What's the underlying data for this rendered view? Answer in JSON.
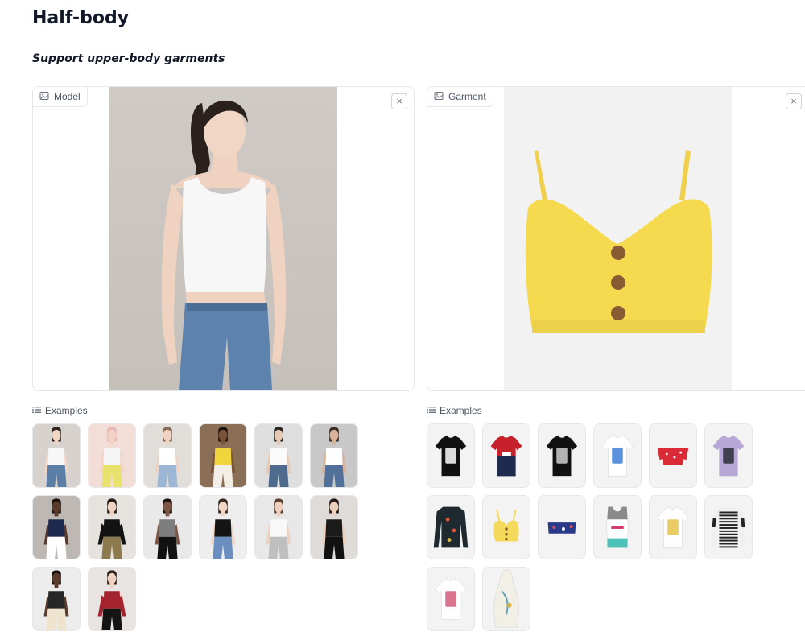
{
  "page": {
    "title": "Half-body",
    "subtitle": "Support upper-body garments"
  },
  "model_input": {
    "label": "Model",
    "label_icon": "image-icon",
    "close_icon": "close-icon",
    "close_symbol": "×"
  },
  "garment_input": {
    "label": "Garment",
    "label_icon": "image-icon",
    "close_icon": "close-icon",
    "close_symbol": "×"
  },
  "model_examples": {
    "label": "Examples",
    "icon": "list-icon",
    "items": [
      {
        "bg": "#d7d2cd",
        "skin": "#f0d5c4",
        "hair": "#2b2421",
        "top": "#f7f7f7",
        "bottom": "#5b7ea6",
        "sleeve": false
      },
      {
        "bg": "#f3ddd7",
        "skin": "#f2d3c5",
        "hair": "#e8b8b5",
        "top": "#f5f5f5",
        "bottom": "#e9e16d",
        "sleeve": false
      },
      {
        "bg": "#e1ddd9",
        "skin": "#f0d3c2",
        "hair": "#8b6e58",
        "top": "#ffffff",
        "bottom": "#9cb7d4",
        "sleeve": false
      },
      {
        "bg": "#8a6e55",
        "skin": "#7a5237",
        "hair": "#1e1510",
        "top": "#f2d53c",
        "bottom": "#f3efe6",
        "sleeve": false
      },
      {
        "bg": "#dedede",
        "skin": "#e6c8b4",
        "hair": "#2a2523",
        "top": "#fbfbfb",
        "bottom": "#4e6b8e",
        "sleeve": false
      },
      {
        "bg": "#c8c8c8",
        "skin": "#d8b39a",
        "hair": "#3a2d25",
        "top": "#ffffff",
        "bottom": "#52719a",
        "sleeve": false
      },
      {
        "bg": "#bdb8b3",
        "skin": "#5a3a2a",
        "hair": "#1c1410",
        "top": "#1f2a4f",
        "bottom": "#ffffff",
        "sleeve": false
      },
      {
        "bg": "#e6e3df",
        "skin": "#efd3c1",
        "hair": "#1f1a18",
        "top": "#121212",
        "bottom": "#8c7a4e",
        "sleeve": true
      },
      {
        "bg": "#e9e9e9",
        "skin": "#7d5441",
        "hair": "#1a1410",
        "top": "#7d7d7d",
        "bottom": "#111111",
        "sleeve": false
      },
      {
        "bg": "#eeeeee",
        "skin": "#f0d6c6",
        "hair": "#3a2a22",
        "top": "#141414",
        "bottom": "#6a8fbf",
        "sleeve": false
      },
      {
        "bg": "#e8e8e8",
        "skin": "#edd0bf",
        "hair": "#5c3f30",
        "top": "#f8f8f8",
        "bottom": "#bfbfbf",
        "sleeve": false
      },
      {
        "bg": "#dedbd8",
        "skin": "#eccfbd",
        "hair": "#231c19",
        "top": "#1a1a1a",
        "bottom": "#111111",
        "sleeve": false
      },
      {
        "bg": "#ececec",
        "skin": "#5b3b2b",
        "hair": "#1a1410",
        "top": "#262626",
        "bottom": "#ede3cf",
        "sleeve": false
      },
      {
        "bg": "#e7e4e1",
        "skin": "#efd2c1",
        "hair": "#2a211d",
        "top": "#a3232f",
        "bottom": "#141414",
        "sleeve": true
      }
    ]
  },
  "garment_examples": {
    "label": "Examples",
    "icon": "list-icon",
    "items": [
      {
        "bg": "#f3f3f3",
        "color": "#111111",
        "accent": "#ffffff",
        "kind": "tee"
      },
      {
        "bg": "#f3f3f3",
        "color": "#ffffff",
        "accent": "#c6202b",
        "kind": "tee-fila"
      },
      {
        "bg": "#f3f3f3",
        "color": "#111111",
        "accent": "#cfcfcf",
        "kind": "tee"
      },
      {
        "bg": "#f3f3f3",
        "color": "#ffffff",
        "accent": "#3f7fd6",
        "kind": "tee"
      },
      {
        "bg": "#f3f3f3",
        "color": "#d92a35",
        "accent": "#ffffff",
        "kind": "offshoulder"
      },
      {
        "bg": "#f3f3f3",
        "color": "#b7a7d6",
        "accent": "#2b2b3a",
        "kind": "tee"
      },
      {
        "bg": "#f3f3f3",
        "color": "#1e2a30",
        "accent": "#e0503a",
        "kind": "longsleeve"
      },
      {
        "bg": "#f3f3f3",
        "color": "#f4d95a",
        "accent": "#8a5a30",
        "kind": "cami"
      },
      {
        "bg": "#f3f3f3",
        "color": "#2a3a8a",
        "accent": "#e45050",
        "kind": "bandeau"
      },
      {
        "bg": "#f3f3f3",
        "color": "#ffffff",
        "accent": "#4cc1b8",
        "kind": "sports"
      },
      {
        "bg": "#f3f3f3",
        "color": "#ffffff",
        "accent": "#e6c34a",
        "kind": "tee"
      },
      {
        "bg": "#f3f3f3",
        "color": "#efefef",
        "accent": "#222222",
        "kind": "stripes"
      },
      {
        "bg": "#f3f3f3",
        "color": "#ffffff",
        "accent": "#d45a7a",
        "kind": "tee"
      },
      {
        "bg": "#f3f3f3",
        "color": "#f2efe6",
        "accent": "#5fa0b4",
        "kind": "halter"
      }
    ]
  },
  "colors": {
    "border": "#e5e7eb",
    "label_text": "#4b5563",
    "garment_yellow": "#f5da4f",
    "button_brown": "#8a5a32"
  }
}
